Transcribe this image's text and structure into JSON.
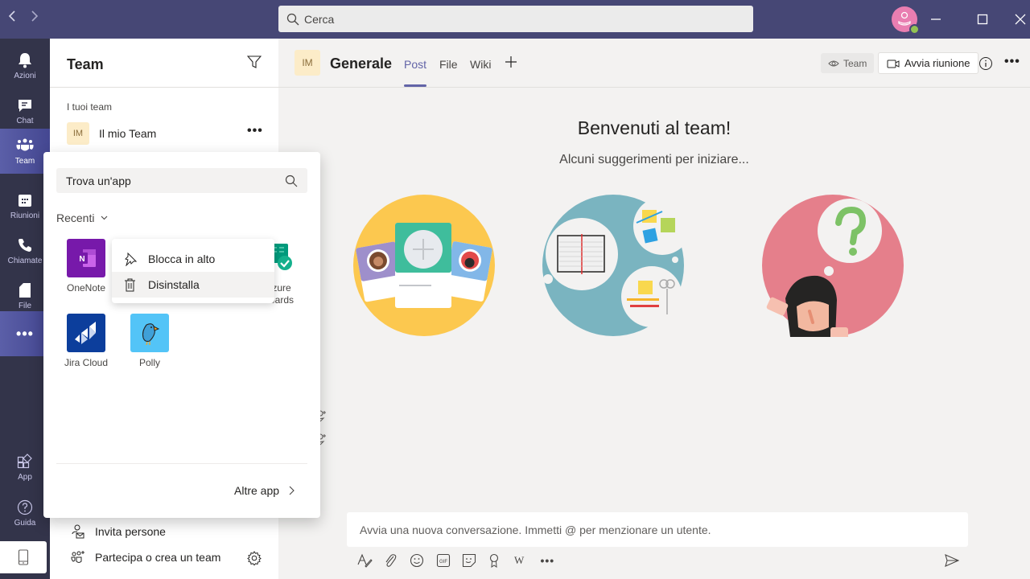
{
  "titlebar": {
    "back_icon": "chevron-left",
    "forward_icon": "chevron-right",
    "search_placeholder": "Cerca",
    "avatar_status": "available",
    "window_controls": [
      "minimize",
      "maximize",
      "close"
    ]
  },
  "rail": {
    "items": [
      {
        "label": "Azioni",
        "icon": "bell-icon"
      },
      {
        "label": "Chat",
        "icon": "chat-icon"
      },
      {
        "label": "Team",
        "icon": "teams-icon",
        "active": true
      },
      {
        "label": "Riunioni",
        "icon": "calendar-icon"
      },
      {
        "label": "Chiamate",
        "icon": "phone-icon"
      },
      {
        "label": "File",
        "icon": "file-icon"
      },
      {
        "label": "•••",
        "icon": "more-icon"
      }
    ],
    "bottom": [
      {
        "label": "App",
        "icon": "apps-icon"
      },
      {
        "label": "Guida",
        "icon": "help-icon"
      }
    ],
    "device_icon": "mobile-icon"
  },
  "teams_panel": {
    "title": "Team",
    "section_label": "I tuoi team",
    "teams": [
      {
        "initials": "IM",
        "name": "Il mio Team",
        "more": "•••"
      }
    ],
    "footer": {
      "invite": "Invita persone",
      "join_create": "Partecipa o crea un team"
    }
  },
  "channel": {
    "initials": "IM",
    "name": "Generale",
    "tabs": [
      {
        "label": "Post",
        "active": true
      },
      {
        "label": "File"
      },
      {
        "label": "Wiki"
      }
    ],
    "team_pill": "Team",
    "meet_button": "Avvia riunione",
    "more": "•••"
  },
  "welcome": {
    "title": "Benvenuti al team!",
    "subtitle": "Alcuni suggerimenti per iniziare..."
  },
  "composer": {
    "placeholder": "Avvia una nuova conversazione. Immetti @ per menzionare un utente.",
    "tools": [
      "format-icon",
      "attach-icon",
      "emoji-icon",
      "gif-icon",
      "sticker-icon",
      "praise-icon",
      "wikipedia-icon",
      "more-icon"
    ],
    "more_label": "•••",
    "gif_label": "GIF",
    "wiki_label": "W"
  },
  "flyout": {
    "search_placeholder": "Trova un'app",
    "section": "Recenti",
    "apps": [
      {
        "name": "OneNote",
        "color": "#7719aa"
      },
      {
        "name": "Azure Boards",
        "color": "#ffffff",
        "visible_label": "ure\nards"
      },
      {
        "name": "Jira Cloud",
        "color": "#0c3e9c"
      },
      {
        "name": "Polly",
        "color": "#53c4f7"
      }
    ],
    "more_apps": "Altre app"
  },
  "context_menu": {
    "items": [
      {
        "label": "Blocca in alto",
        "icon": "pin-icon"
      },
      {
        "label": "Disinstalla",
        "icon": "trash-icon",
        "hover": true
      }
    ]
  },
  "colors": {
    "brand": "#464775",
    "rail": "#33344a",
    "accent": "#6264a7"
  }
}
